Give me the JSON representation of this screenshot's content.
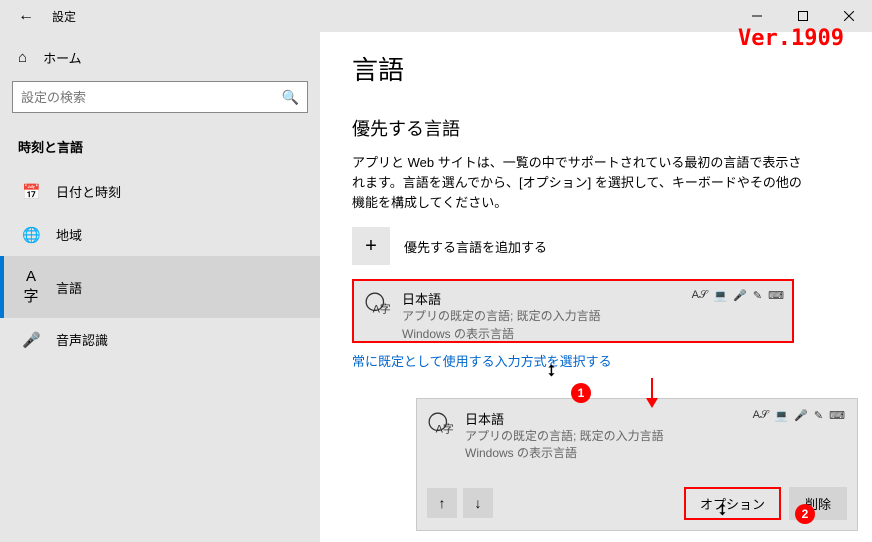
{
  "window": {
    "title": "設定"
  },
  "version_badge": "Ver.1909",
  "sidebar": {
    "home": "ホーム",
    "search_placeholder": "設定の検索",
    "section": "時刻と言語",
    "items": [
      {
        "label": "日付と時刻"
      },
      {
        "label": "地域"
      },
      {
        "label": "言語"
      },
      {
        "label": "音声認識"
      }
    ]
  },
  "content": {
    "title": "言語",
    "preferred_header": "優先する言語",
    "preferred_desc": "アプリと Web サイトは、一覧の中でサポートされている最初の言語で表示されます。言語を選んでから、[オプション] を選択して、キーボードやその他の機能を構成してください。",
    "add_label": "優先する言語を追加する",
    "lang": {
      "name": "日本語",
      "sub1": "アプリの既定の言語; 既定の入力言語",
      "sub2": "Windows の表示言語"
    },
    "truncated_link": "常に既定として使用する入力方式を選択する"
  },
  "expanded": {
    "name": "日本語",
    "sub1": "アプリの既定の言語; 既定の入力言語",
    "sub2": "Windows の表示言語",
    "options_label": "オプション",
    "delete_label": "削除"
  },
  "markers": {
    "one": "1",
    "two": "2"
  }
}
